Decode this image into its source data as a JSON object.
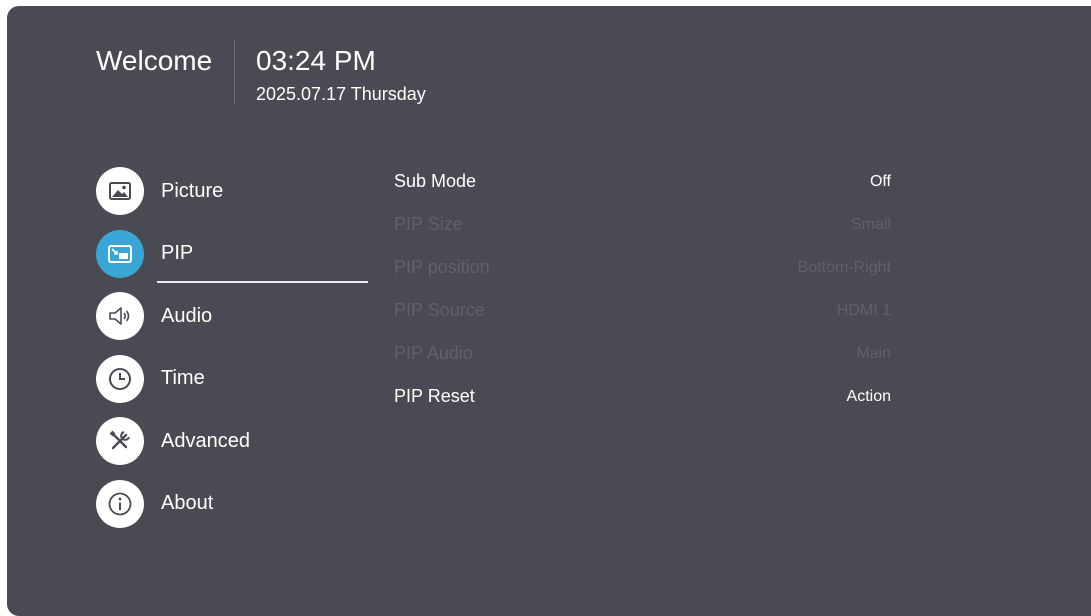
{
  "header": {
    "welcome": "Welcome",
    "time": "03:24 PM",
    "date": "2025.07.17 Thursday"
  },
  "menu": {
    "items": [
      {
        "label": "Picture",
        "icon": "picture-icon"
      },
      {
        "label": "PIP",
        "icon": "pip-icon",
        "active": true
      },
      {
        "label": "Audio",
        "icon": "speaker-icon"
      },
      {
        "label": "Time",
        "icon": "clock-icon"
      },
      {
        "label": "Advanced",
        "icon": "tools-icon"
      },
      {
        "label": "About",
        "icon": "info-icon"
      }
    ]
  },
  "settings": {
    "rows": [
      {
        "label": "Sub Mode",
        "value": "Off",
        "enabled": true
      },
      {
        "label": "PIP Size",
        "value": "Small",
        "enabled": false
      },
      {
        "label": "PIP position",
        "value": "Bottom-Right",
        "enabled": false
      },
      {
        "label": "PIP Source",
        "value": "HDMI 1",
        "enabled": false
      },
      {
        "label": "PIP Audio",
        "value": "Main",
        "enabled": false
      },
      {
        "label": "PIP Reset",
        "value": "Action",
        "enabled": true
      }
    ]
  },
  "colors": {
    "background": "#4a4a53",
    "accent": "#3aa6d6",
    "text": "#ffffff",
    "disabled_text": "#61616b"
  }
}
